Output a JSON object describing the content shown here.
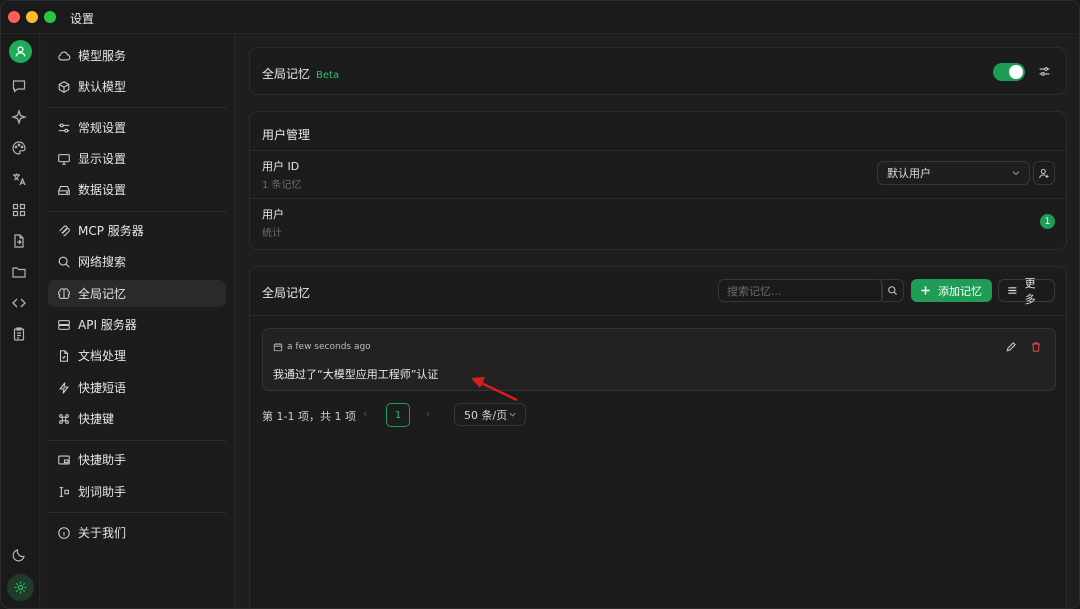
{
  "window": {
    "title": "设置"
  },
  "rail": {
    "icons": [
      "chat-icon",
      "sparkle-icon",
      "palette-icon",
      "translate-icon",
      "apps-icon",
      "document-swap-icon",
      "folder-icon",
      "code-icon",
      "clipboard-icon"
    ],
    "bottom": [
      "moon-icon",
      "gear-icon"
    ]
  },
  "menu": {
    "items": [
      {
        "label": "模型服务",
        "icon": "cloud-icon"
      },
      {
        "label": "默认模型",
        "icon": "cube-icon"
      },
      {
        "label": "常规设置",
        "icon": "sliders-icon"
      },
      {
        "label": "显示设置",
        "icon": "monitor-icon"
      },
      {
        "label": "数据设置",
        "icon": "drive-icon"
      },
      {
        "label": "MCP 服务器",
        "icon": "mcp-icon"
      },
      {
        "label": "网络搜索",
        "icon": "search-icon"
      },
      {
        "label": "全局记忆",
        "icon": "brain-icon",
        "active": true
      },
      {
        "label": "API 服务器",
        "icon": "server-icon"
      },
      {
        "label": "文档处理",
        "icon": "file-icon"
      },
      {
        "label": "快捷短语",
        "icon": "zap-icon"
      },
      {
        "label": "快捷键",
        "icon": "command-icon"
      },
      {
        "label": "快捷助手",
        "icon": "window-icon"
      },
      {
        "label": "划词助手",
        "icon": "text-select-icon"
      },
      {
        "label": "关于我们",
        "icon": "info-icon"
      }
    ]
  },
  "global_memory": {
    "title": "全局记忆",
    "badge": "Beta",
    "enabled": true
  },
  "user_mgmt": {
    "title": "用户管理",
    "user_id_label": "用户 ID",
    "user_id_sub": "1 条记忆",
    "selected_user": "默认用户",
    "user_label": "用户",
    "user_sub": "统计",
    "user_count": "1"
  },
  "memories": {
    "title": "全局记忆",
    "search_placeholder": "搜索记忆...",
    "add_label": "添加记忆",
    "more_label": "更多",
    "items": [
      {
        "time": "a few seconds ago",
        "text": "我通过了“大模型应用工程师”认证"
      }
    ],
    "pagination": {
      "summary": "第 1-1 项，共 1 项",
      "current": "1",
      "page_size": "50 条/页",
      "prev": "‹",
      "next": "›"
    }
  },
  "colors": {
    "accent": "#1f9d55",
    "annotation_arrow": "#d81e1e"
  }
}
